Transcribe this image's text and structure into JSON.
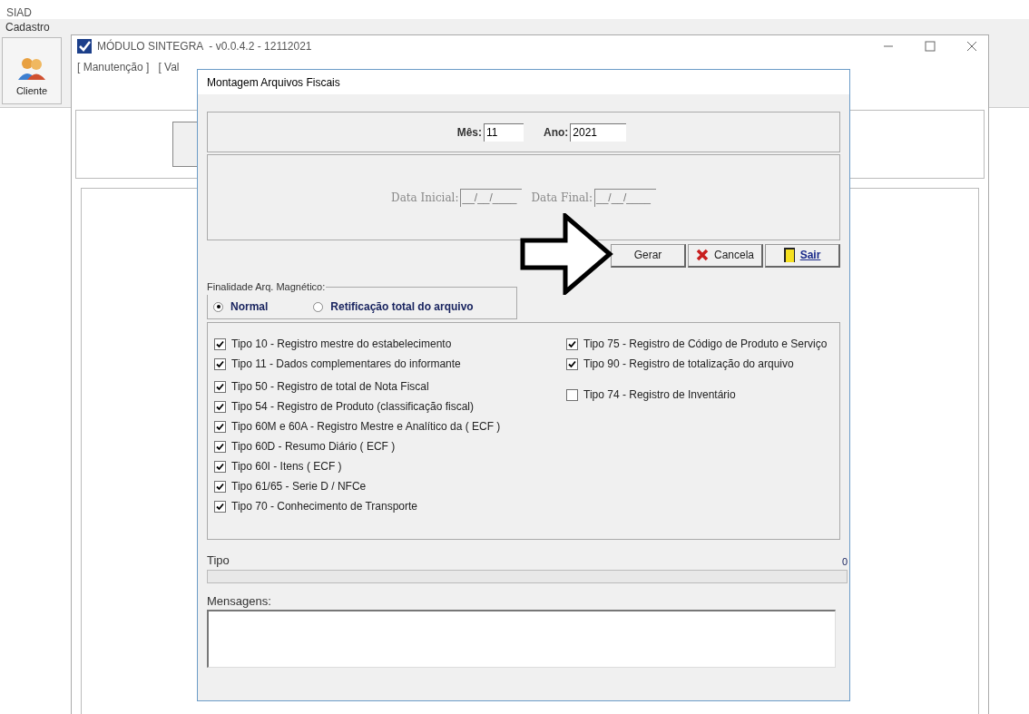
{
  "app": {
    "title": "SIAD",
    "menu": [
      "Cadastro"
    ],
    "toolbar": [
      {
        "label": "Cliente"
      }
    ]
  },
  "sintegra_window": {
    "title": "MÓDULO SINTEGRA  - v0.0.4.2 - 12112021",
    "menu": [
      "[ Manutenção ]",
      "[ Val"
    ]
  },
  "dialog": {
    "title": "Montagem Arquivos Fiscais",
    "mes": {
      "label": "Mês:",
      "value": "11"
    },
    "ano": {
      "label": "Ano:",
      "value": "2021"
    },
    "data_inicial": {
      "label": "Data Inicial:",
      "value": "__/__/____",
      "disabled": true
    },
    "data_final": {
      "label": "Data Final:",
      "value": "__/__/____",
      "disabled": true
    },
    "buttons": [
      {
        "kind": "plain",
        "label": "Gerar"
      },
      {
        "kind": "cancel",
        "label": "Cancela"
      },
      {
        "kind": "exit",
        "label": "Sair"
      }
    ],
    "finalidade": {
      "title": "Finalidade Arq. Magnético:",
      "options": [
        {
          "label": "Normal",
          "selected": true
        },
        {
          "label": "Retificação total do arquivo",
          "selected": false
        }
      ]
    },
    "tipos_left": [
      {
        "label": "Tipo 10 - Registro mestre do estabelecimento",
        "checked": true
      },
      {
        "label": "Tipo 11 - Dados complementares do informante",
        "checked": true
      },
      {
        "label": "Tipo 50 - Registro de total de Nota Fiscal",
        "checked": true
      },
      {
        "label": "Tipo 54 - Registro de Produto (classificação fiscal)",
        "checked": true
      },
      {
        "label": "Tipo 60M e 60A - Registro Mestre e Analítico da ( ECF )",
        "checked": true
      },
      {
        "label": "Tipo 60D - Resumo Diário ( ECF )",
        "checked": true
      },
      {
        "label": "Tipo 60I - Itens ( ECF )",
        "checked": true
      },
      {
        "label": "Tipo 61/65 - Serie D / NFCe",
        "checked": true
      },
      {
        "label": "Tipo 70 - Conhecimento de Transporte",
        "checked": true
      }
    ],
    "tipos_right": [
      {
        "label": "Tipo 75 - Registro de Código de Produto e Serviço",
        "checked": true
      },
      {
        "label": "Tipo 90 - Registro de totalização do arquivo",
        "checked": true
      },
      {
        "label": "Tipo 74 - Registro de Inventário",
        "checked": false
      }
    ],
    "progress": {
      "label": "Tipo",
      "count": "0",
      "level": 0
    },
    "mensagens": {
      "label": "Mensagens:"
    }
  }
}
